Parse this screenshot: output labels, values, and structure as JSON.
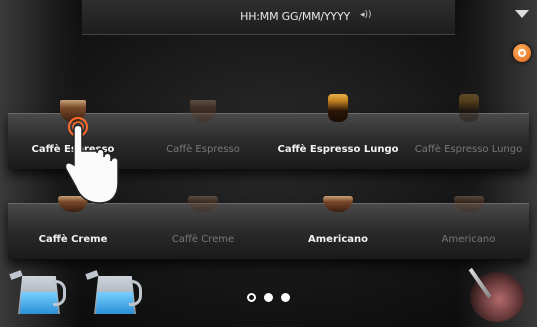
{
  "status_bar": {
    "datetime": "HH:MM GG/MM/YYYY",
    "volume_icon": "speaker-icon"
  },
  "shelf1": [
    {
      "label": "Caffè Espresso",
      "dim": false,
      "cup": "small"
    },
    {
      "label": "Caffè Espresso",
      "dim": true,
      "cup": "small"
    },
    {
      "label": "Caffè Espresso Lungo",
      "dim": false,
      "cup": "glass"
    },
    {
      "label": "Caffè Espresso Lungo",
      "dim": true,
      "cup": "glass"
    }
  ],
  "shelf2": [
    {
      "label": "Caffè Creme",
      "dim": false,
      "cup": "wide"
    },
    {
      "label": "Caffè Creme",
      "dim": true,
      "cup": "wide"
    },
    {
      "label": "Americano",
      "dim": false,
      "cup": "wide"
    },
    {
      "label": "Americano",
      "dim": true,
      "cup": "wide"
    }
  ],
  "pager": {
    "pages": 3,
    "current": 1
  },
  "colors": {
    "accent_orange": "#e0641a",
    "milk_blue": "#2a8fd8"
  }
}
